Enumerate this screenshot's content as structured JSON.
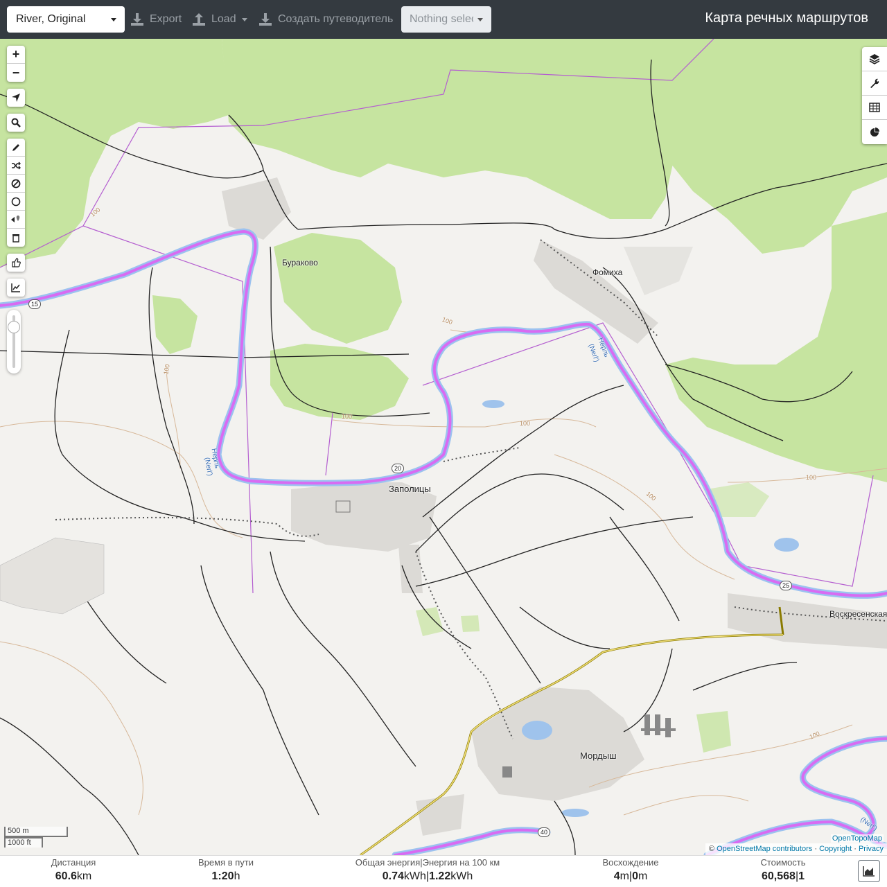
{
  "topbar": {
    "profile_value": "River, Original",
    "export_label": "Export",
    "load_label": "Load",
    "guide_label": "Создать путеводитель",
    "selection_value": "Nothing selected",
    "app_title": "Карта речных маршрутов"
  },
  "map": {
    "labels": {
      "burakovo": "Бураково",
      "fomikha": "Фомиха",
      "zapolitsy": "Заполицы",
      "mordysh": "Мордыш",
      "voskresenskaya": "Воскресенская С",
      "river_a": "Нерль",
      "river_a_latin": "(Nerl')",
      "river_b": "Нерль",
      "river_b_latin": "(Nerl')",
      "river_c": "(Nerl')"
    },
    "contour_label": "100",
    "road_numbers": {
      "r15": "15",
      "r20": "20",
      "r25": "25",
      "r40": "40"
    },
    "scale": {
      "metric": "500 m",
      "imperial": "1000 ft"
    },
    "credit_topo": "OpenTopoMap",
    "attribution": {
      "prefix": "©",
      "osm": "OpenStreetMap contributors",
      "sep1": "·",
      "copyright": "Copyright",
      "sep2": "·",
      "privacy": "Privacy"
    }
  },
  "colors": {
    "route": "#d65cf5",
    "river": "#8fb4e6",
    "forest": "#c3e39a",
    "topbar": "#343a40"
  },
  "stats": {
    "distance": {
      "label": "Дистанция",
      "value": "60.6",
      "unit": "km"
    },
    "time": {
      "label": "Время в пути",
      "value": "1:20",
      "unit": "h"
    },
    "energy": {
      "label": "Общая энергия|Энергия на 100 км",
      "value1": "0.74",
      "unit1": "kWh",
      "sep": "|",
      "value2": "1.22",
      "unit2": "kWh"
    },
    "ascent": {
      "label": "Восхождение",
      "value1": "4",
      "unit1": "m",
      "sep": "|",
      "value2": "0",
      "unit2": "m"
    },
    "cost": {
      "label": "Стоимость",
      "value1": "60,568",
      "sep": "|",
      "value2": "1"
    }
  },
  "icons": [
    "zoom-in-icon",
    "zoom-out-icon",
    "locate-icon",
    "search-icon",
    "draw-icon",
    "shuffle-icon",
    "nogo-icon",
    "circle-icon",
    "poi-icon",
    "trash-icon",
    "thumb-icon",
    "elevation-icon",
    "layers-icon",
    "wrench-icon",
    "table-icon",
    "pie-chart-icon",
    "area-chart-icon"
  ]
}
